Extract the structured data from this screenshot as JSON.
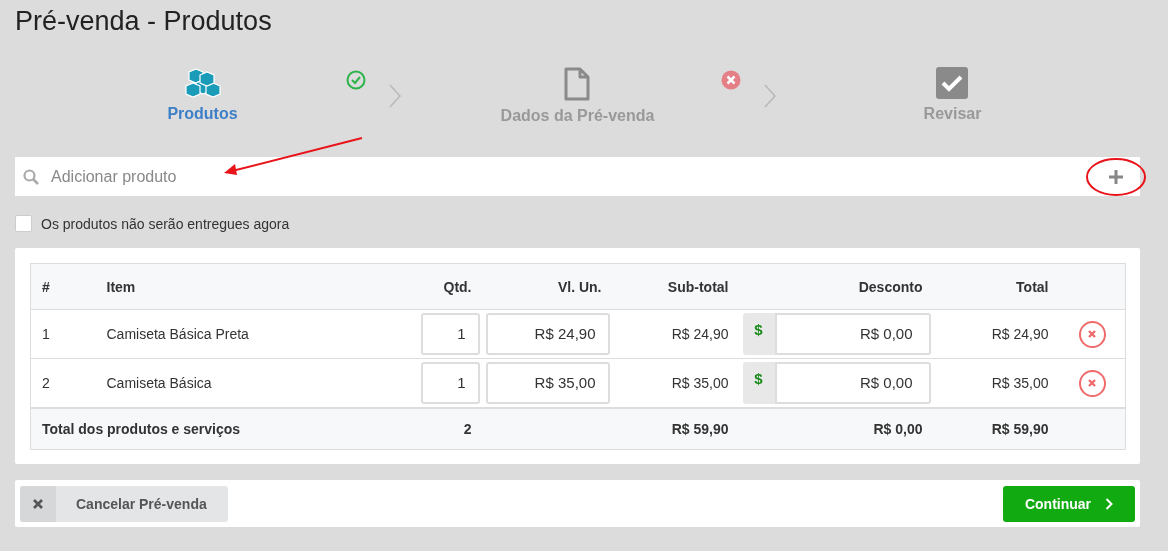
{
  "page_title": "Pré-venda - Produtos",
  "steps": [
    {
      "label": "Produtos",
      "selected": true,
      "kind": "done"
    },
    {
      "label": "Dados da Pré-venda",
      "selected": false,
      "kind": "error"
    },
    {
      "label": "Revisar",
      "selected": false,
      "kind": "pending"
    }
  ],
  "search": {
    "placeholder": "Adicionar produto"
  },
  "not_delivered": {
    "label": "Os produtos não serão entregues agora",
    "checked": false
  },
  "table": {
    "columns": [
      "#",
      "Item",
      "Qtd.",
      "Vl. Un.",
      "Sub-total",
      "Desconto",
      "Total"
    ],
    "rows": [
      {
        "index": "1",
        "item": "Camiseta Básica Preta",
        "qty": "1",
        "unit_price": "R$ 24,90",
        "subtotal": "R$ 24,90",
        "discount_symbol": "$",
        "discount": "R$ 0,00",
        "total": "R$ 24,90"
      },
      {
        "index": "2",
        "item": "Camiseta Básica",
        "qty": "1",
        "unit_price": "R$ 35,00",
        "subtotal": "R$ 35,00",
        "discount_symbol": "$",
        "discount": "R$ 0,00",
        "total": "R$ 35,00"
      }
    ],
    "footer": {
      "label": "Total dos produtos e serviços",
      "qty": "2",
      "subtotal": "R$ 59,90",
      "discount": "R$ 0,00",
      "total": "R$ 59,90"
    }
  },
  "cancel_button": "Cancelar Pré-venda",
  "continue_button": "Continuar"
}
